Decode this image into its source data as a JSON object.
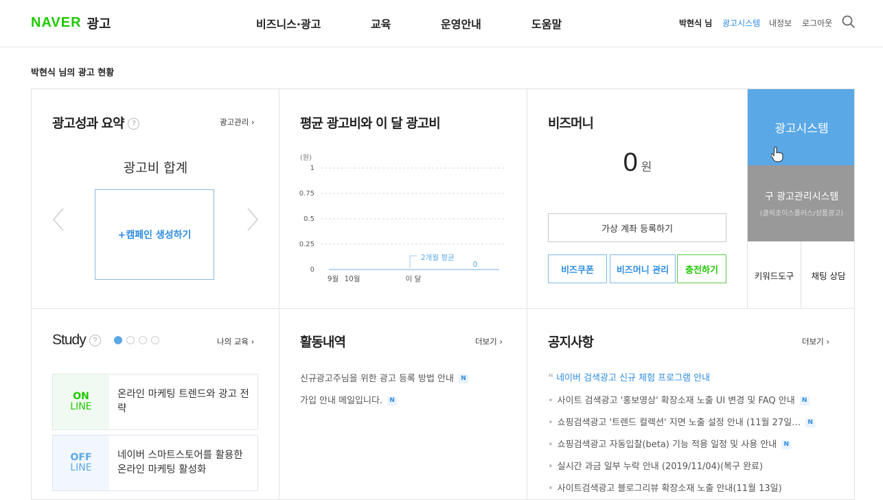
{
  "header": {
    "logo_brand": "NAVER",
    "logo_service": "광고",
    "gnb": [
      "비즈니스·광고",
      "교육",
      "운영안내",
      "도움말"
    ],
    "user": "박현식 님",
    "util_links": [
      "광고시스템",
      "내정보",
      "로그아웃"
    ]
  },
  "page_title": "박현식 님의 광고 현황",
  "summary": {
    "title": "광고성과 요약",
    "help": "?",
    "more_label": "광고관리",
    "subtitle": "광고비 합계",
    "create_label": "+캠페인 생성하기"
  },
  "cost": {
    "title": "평균 광고비와 이 달 광고비"
  },
  "chart_data": {
    "type": "line",
    "ylabel": "(원)",
    "yticks": [
      "1",
      "0.75",
      "0.5",
      "0.25",
      "0"
    ],
    "ylim": [
      0,
      1
    ],
    "x": [
      "9월",
      "10월",
      "이 달"
    ],
    "series": [
      {
        "values": [
          0,
          0,
          0
        ]
      }
    ],
    "annotation": "2개월 평균",
    "value_label": "0",
    "grid": true
  },
  "bizmoney": {
    "title": "비즈머니",
    "amount": "0",
    "unit": "원",
    "register_label": "가상 계좌 등록하기",
    "buttons": [
      "비즈쿠폰",
      "비즈머니 관리",
      "충전하기"
    ]
  },
  "system": {
    "main_label": "광고시스템",
    "old_label": "구 광고관리시스템",
    "old_sub": "(클릭초이스플러스/상품광고)",
    "tools": [
      "키워드도구",
      "채팅 상담"
    ]
  },
  "study": {
    "title": "Study",
    "help": "?",
    "more_label": "나의 교육",
    "cards": [
      {
        "tag_top": "ON",
        "tag_bottom": "LINE",
        "text": "온라인 마케팅 트렌드와 광고 전략"
      },
      {
        "tag_top": "OFF",
        "tag_bottom": "LINE",
        "text": "네이버 스마트스토어를 활용한 온라인 마케팅 활성화"
      }
    ]
  },
  "activity": {
    "title": "활동내역",
    "more_label": "더보기",
    "items": [
      "신규광고주님을 위한 광고 등록 방법 안내",
      "가입 안내 메일입니다."
    ],
    "badge": "N"
  },
  "notice": {
    "title": "공지사항",
    "more_label": "더보기",
    "quote_mark": "❝",
    "highlight": "네이버 검색광고 신규 체험 프로그램 안내",
    "items": [
      {
        "text": "사이트 검색광고 '홍보영상' 확장소재 노출 UI 변경 및 FAQ 안내",
        "new": true
      },
      {
        "text": "쇼핑검색광고 '트렌드 컬렉션' 지면 노출 설정 안내 (11월 27일…",
        "new": true
      },
      {
        "text": "쇼핑검색광고 자동입찰(beta) 기능 적용 일정 및 사용 안내",
        "new": true
      },
      {
        "text": "실시간 과금 일부 누락 안내 (2019/11/04)(복구 완료)",
        "new": false
      },
      {
        "text": "사이트검색광고 블로그리뷰 확장소재 노출 안내(11월 13일)",
        "new": false
      }
    ],
    "badge": "N"
  }
}
